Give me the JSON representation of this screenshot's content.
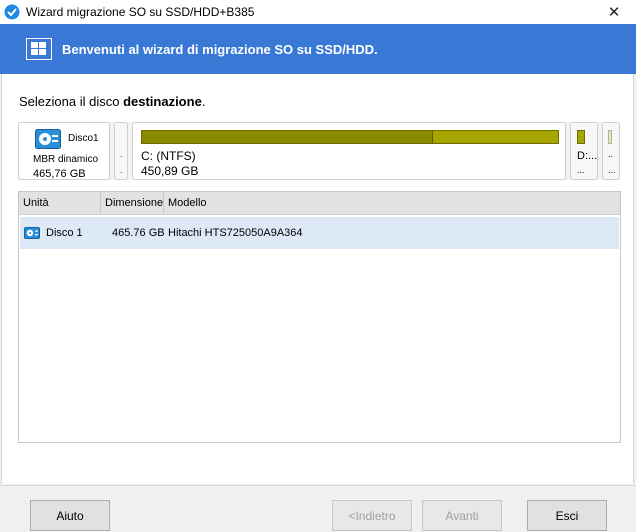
{
  "window": {
    "title": "Wizard migrazione SO su SSD/HDD+B385",
    "close_glyph": "✕"
  },
  "banner": {
    "title": "Benvenuti al wizard di migrazione SO su SSD/HDD."
  },
  "main": {
    "prompt_prefix": "Seleziona il disco ",
    "prompt_bold": "destinazione",
    "prompt_suffix": "."
  },
  "disk_map": {
    "disk_name": "Disco1",
    "disk_type": "MBR dinamico",
    "disk_size": "465,76 GB",
    "small_segment_dot1": ".",
    "small_segment_dot2": ".",
    "partition_c": {
      "label": "C: (NTFS)",
      "size": "450,89 GB",
      "used_fraction": 0.7
    },
    "partition_d": {
      "label": "D:...",
      "dots": "..."
    },
    "partition_e": {
      "dots1": "..",
      "dots2": "..."
    },
    "colors": {
      "used": "#8a8a00",
      "free": "#a7a600"
    }
  },
  "table": {
    "headers": [
      "Unità",
      "Dimensione",
      "Modello"
    ],
    "rows": [
      {
        "unit": "Disco 1",
        "size": "465.76 GB",
        "model": "Hitachi HTS725050A9A364"
      }
    ]
  },
  "buttons": {
    "help": "Aiuto",
    "back": "<Indietro",
    "next": "Avanti",
    "exit": "Esci"
  },
  "colors": {
    "banner": "#3a78d6",
    "selected_row": "#dde9f7"
  },
  "icons": {
    "app": "wizard-app-icon",
    "banner": "windows-migrate-icon",
    "disk": "hard-disk-icon",
    "row_disk": "hard-disk-small-icon"
  }
}
